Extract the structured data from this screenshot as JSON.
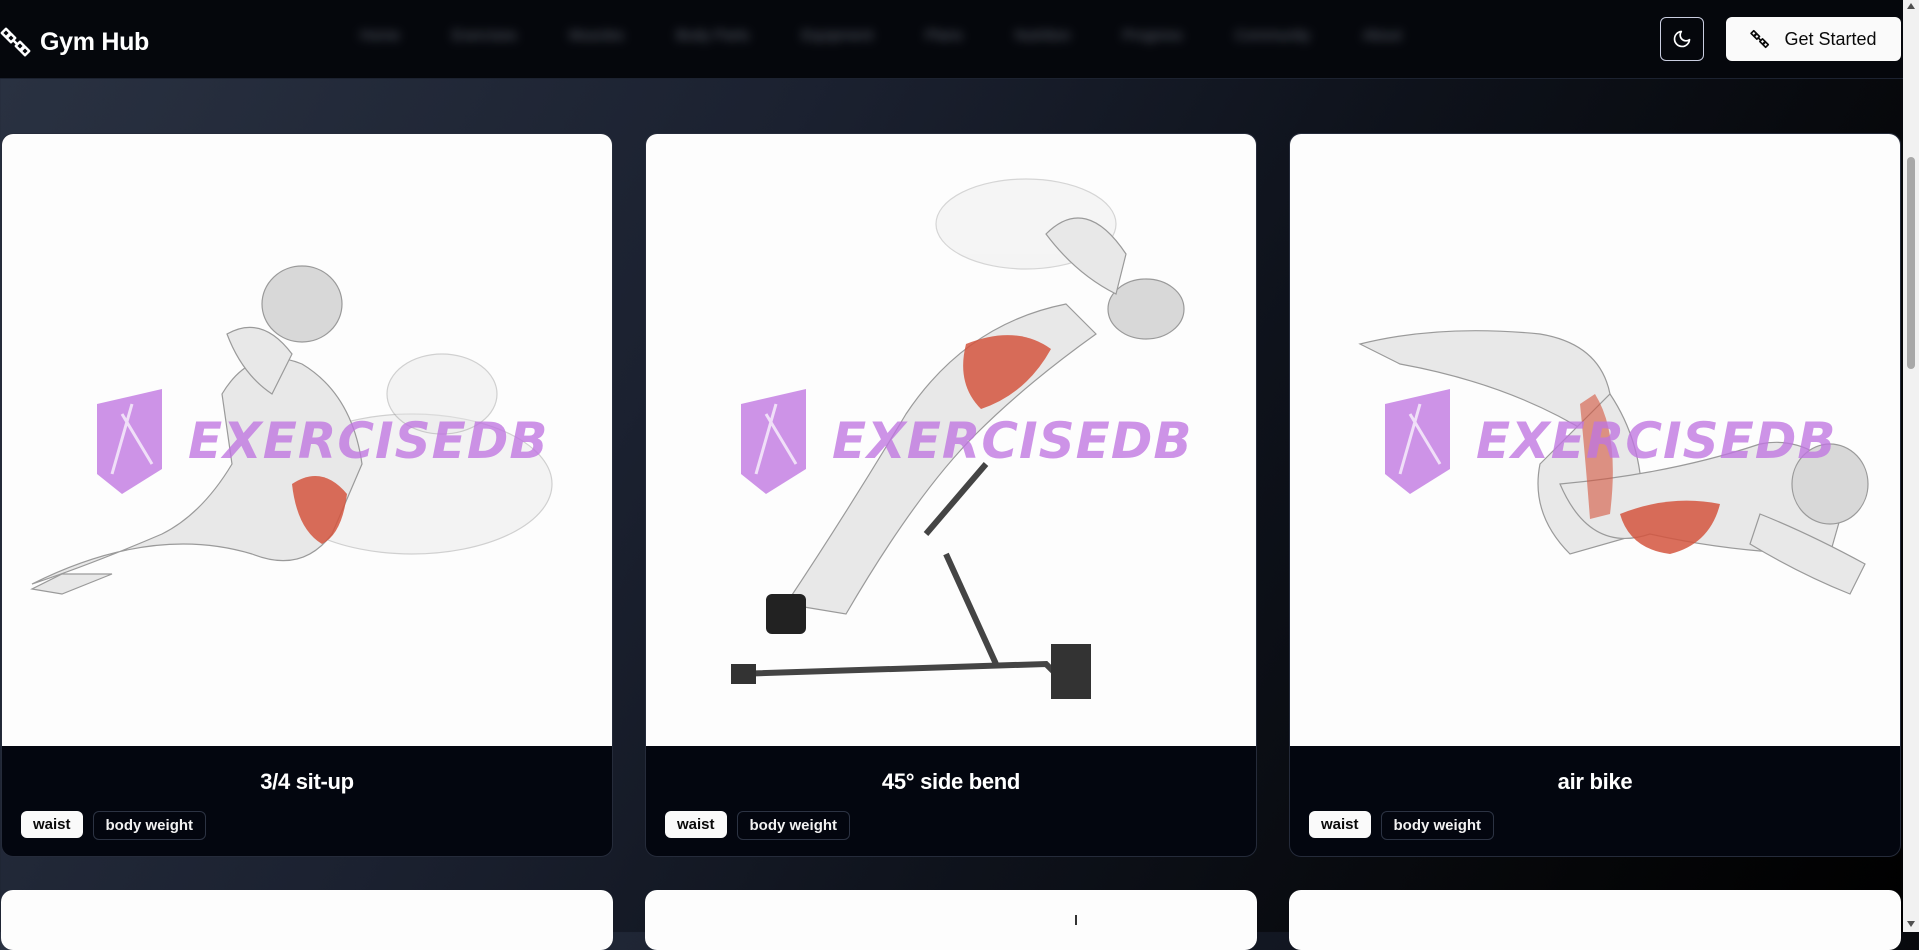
{
  "app": {
    "name": "Gym Hub"
  },
  "nav": {
    "links": [
      "Home",
      "Exercises",
      "Muscles",
      "Body Parts",
      "Equipment",
      "Plans",
      "Nutrition",
      "Progress",
      "Community",
      "About"
    ],
    "theme_icon": "moon-icon",
    "cta_label": "Get Started",
    "cta_icon": "dumbbell-icon"
  },
  "watermark": {
    "text": "EXERCISEDB",
    "color": "#c58ee6"
  },
  "exercises": [
    {
      "name": "3/4 sit-up",
      "body_part": "waist",
      "equipment": "body weight"
    },
    {
      "name": "45° side bend",
      "body_part": "waist",
      "equipment": "body weight"
    },
    {
      "name": "air bike",
      "body_part": "waist",
      "equipment": "body weight"
    }
  ],
  "colors": {
    "accent": "#fafafa",
    "card_bg": "#03060f",
    "muscle_highlight": "#d4553e"
  }
}
